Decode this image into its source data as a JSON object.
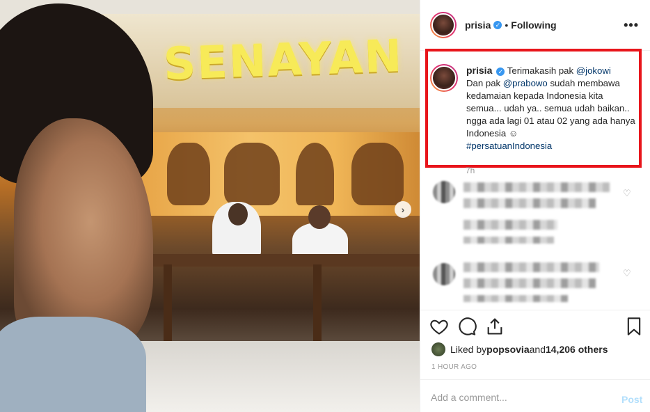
{
  "header": {
    "username": "prisia",
    "separator": "•",
    "follow_status": "Following",
    "more_label": "•••"
  },
  "caption": {
    "username": "prisia",
    "text_1": "Terimakasih pak ",
    "mention_1": "@jokowi",
    "text_2": "Dan pak ",
    "mention_2": "@prabowo",
    "text_3": " sudah membawa kedamaian kepada Indonesia kita semua... udah ya.. semua udah baikan.. ngga ada lagi 01 atau 02 yang ada hanya Indonesia ☺",
    "hashtag": "#persatuanIndonesia",
    "time_label": "7h"
  },
  "photo": {
    "sign_text": "SENAYAN"
  },
  "likes": {
    "prefix": "Liked by ",
    "user": "popsovia",
    "middle": " and ",
    "count": "14,206 others"
  },
  "post_age": "1 HOUR AGO",
  "comment_box": {
    "placeholder": "Add a comment...",
    "post_label": "Post"
  },
  "colors": {
    "highlight_border": "#e8151b",
    "verified_blue": "#3897f0",
    "link": "#003569"
  },
  "icons": [
    "verified-icon",
    "more-options-icon",
    "heart-icon",
    "comment-icon",
    "share-icon",
    "bookmark-icon",
    "next-arrow-icon"
  ]
}
